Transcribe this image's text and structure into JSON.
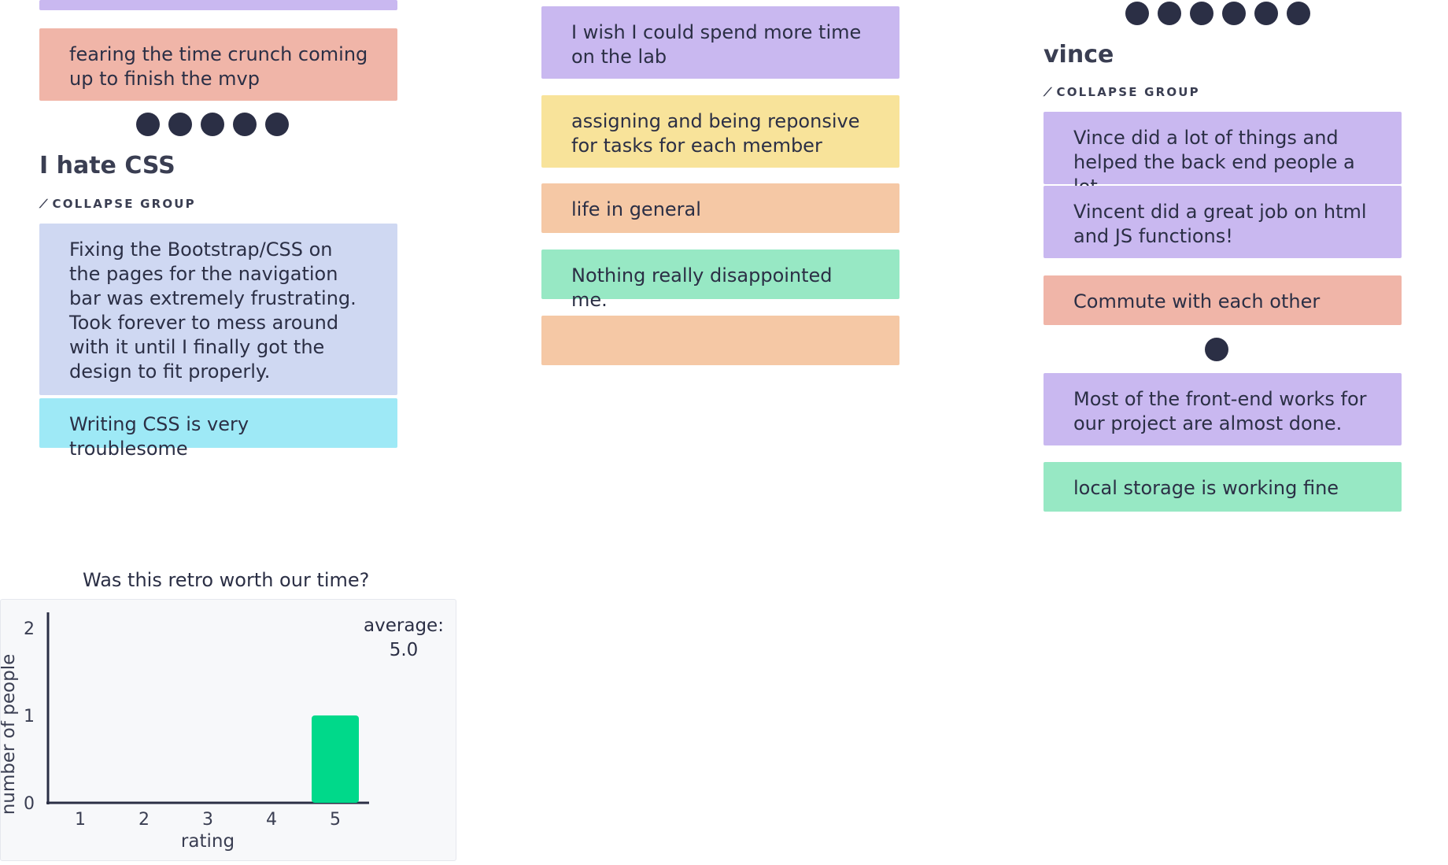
{
  "colors": {
    "purple": "#c9b8f0",
    "salmon": "#f0b5a8",
    "yellow": "#f8e39a",
    "peach": "#f5c8a5",
    "green": "#97e8c4",
    "lavender": "#cfd8f2",
    "cyan": "#9ee9f6",
    "dot": "#2b2f45",
    "bar": "#00d98a"
  },
  "left": {
    "card_salmon": "fearing the time crunch coming up to finish the mvp",
    "group_title": "I hate CSS",
    "collapse_label": "COLLAPSE GROUP",
    "card_css_long": "Fixing the Bootstrap/CSS on the pages for the navigation bar was extremely frustrating. Took forever to mess around with it until I finally got the design to fit properly.",
    "card_css_short": "Writing CSS is very troublesome",
    "vote_dots": 5
  },
  "middle": {
    "cards": [
      "I wish I could spend more time on the lab",
      "assigning and being reponsive for tasks for each member",
      "life in general",
      "Nothing really disappointed me.",
      ""
    ]
  },
  "right": {
    "vote_dots_top": 6,
    "group_title": "vince",
    "collapse_label": "COLLAPSE GROUP",
    "card_vince_1": "Vince did a lot of things and helped the back end people a lot",
    "card_vince_2": "Vincent did a great job on html and JS functions!",
    "card_commute": "Commute with each other",
    "vote_dots_mid": 1,
    "card_frontend": "Most of the front-end works for our project are almost done.",
    "card_storage": "local storage is working fine"
  },
  "chart_data": {
    "type": "bar",
    "title": "Was this retro worth our time?",
    "categories": [
      "1",
      "2",
      "3",
      "4",
      "5"
    ],
    "values": [
      0,
      0,
      0,
      0,
      1
    ],
    "xlabel": "rating",
    "ylabel": "number of people",
    "ylim": [
      0,
      2
    ],
    "yticks": [
      "0",
      "1",
      "2"
    ],
    "average_label": "average:",
    "average_value": "5.0"
  }
}
